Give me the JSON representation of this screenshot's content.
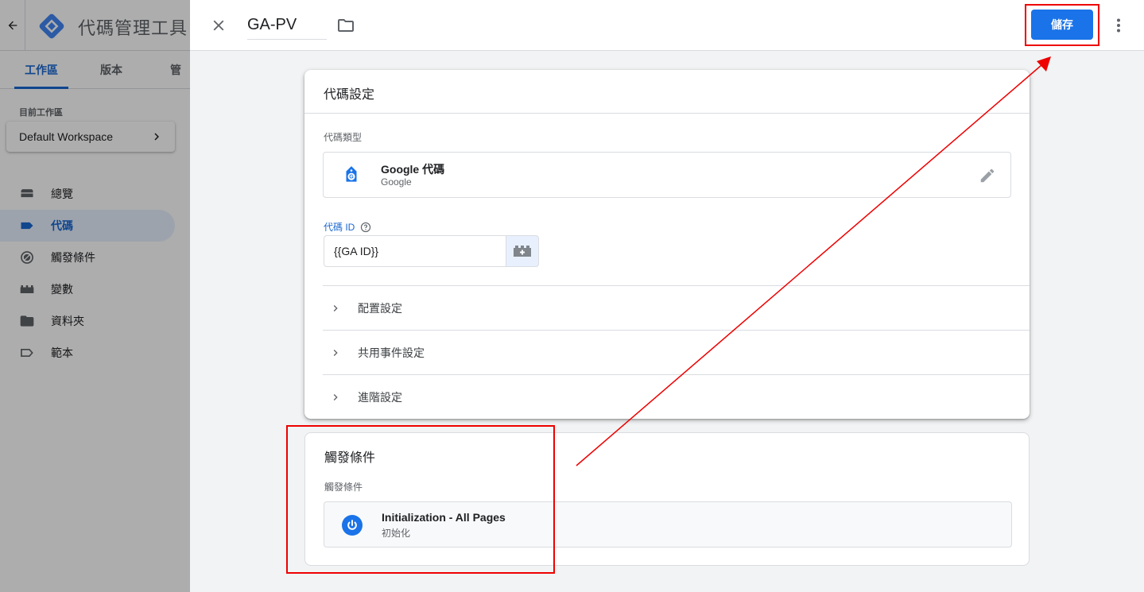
{
  "app": {
    "title": "代碼管理工具",
    "tabs": [
      {
        "label": "工作區",
        "active": true
      },
      {
        "label": "版本",
        "active": false
      },
      {
        "label": "管理",
        "active": false
      }
    ],
    "workspace_label": "目前工作區",
    "workspace_name": "Default Workspace",
    "nav": [
      {
        "label": "總覽",
        "icon": "overview-icon",
        "active": false
      },
      {
        "label": "代碼",
        "icon": "tag-icon",
        "active": true
      },
      {
        "label": "觸發條件",
        "icon": "trigger-icon",
        "active": false
      },
      {
        "label": "變數",
        "icon": "variable-icon",
        "active": false
      },
      {
        "label": "資料夾",
        "icon": "folder-icon",
        "active": false
      },
      {
        "label": "範本",
        "icon": "template-icon",
        "active": false
      }
    ]
  },
  "sheet": {
    "tag_name": "GA-PV",
    "save_label": "儲存",
    "config_card": {
      "title": "代碼設定",
      "type_label": "代碼類型",
      "type_name": "Google 代碼",
      "type_vendor": "Google",
      "tag_id_label": "代碼 ID",
      "tag_id_value": "{{GA ID}}",
      "sections": [
        "配置設定",
        "共用事件設定",
        "進階設定"
      ]
    },
    "trigger_card": {
      "title": "觸發條件",
      "label": "觸發條件",
      "trigger_name": "Initialization - All Pages",
      "trigger_type": "初始化"
    }
  },
  "colors": {
    "primary": "#1a73e8",
    "annotation": "#e00000"
  }
}
